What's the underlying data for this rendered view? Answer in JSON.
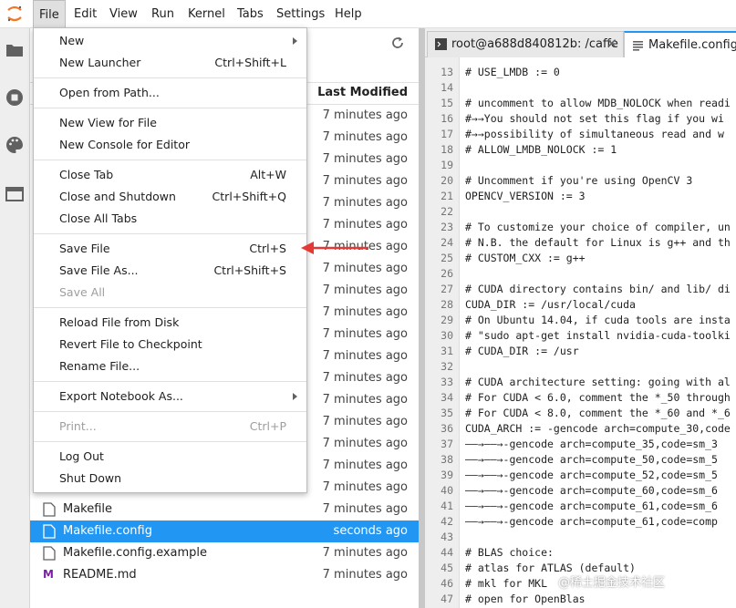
{
  "menubar": {
    "items": [
      "File",
      "Edit",
      "View",
      "Run",
      "Kernel",
      "Tabs",
      "Settings",
      "Help"
    ]
  },
  "file_menu": {
    "groups": [
      [
        {
          "label": "New",
          "shortcut": "",
          "submenu": true,
          "disabled": false
        },
        {
          "label": "New Launcher",
          "shortcut": "Ctrl+Shift+L",
          "submenu": false,
          "disabled": false
        }
      ],
      [
        {
          "label": "Open from Path...",
          "shortcut": "",
          "submenu": false,
          "disabled": false
        }
      ],
      [
        {
          "label": "New View for File",
          "shortcut": "",
          "submenu": false,
          "disabled": false
        },
        {
          "label": "New Console for Editor",
          "shortcut": "",
          "submenu": false,
          "disabled": false
        }
      ],
      [
        {
          "label": "Close Tab",
          "shortcut": "Alt+W",
          "submenu": false,
          "disabled": false
        },
        {
          "label": "Close and Shutdown",
          "shortcut": "Ctrl+Shift+Q",
          "submenu": false,
          "disabled": false
        },
        {
          "label": "Close All Tabs",
          "shortcut": "",
          "submenu": false,
          "disabled": false
        }
      ],
      [
        {
          "label": "Save File",
          "shortcut": "Ctrl+S",
          "submenu": false,
          "disabled": false
        },
        {
          "label": "Save File As...",
          "shortcut": "Ctrl+Shift+S",
          "submenu": false,
          "disabled": false
        },
        {
          "label": "Save All",
          "shortcut": "",
          "submenu": false,
          "disabled": true
        }
      ],
      [
        {
          "label": "Reload File from Disk",
          "shortcut": "",
          "submenu": false,
          "disabled": false
        },
        {
          "label": "Revert File to Checkpoint",
          "shortcut": "",
          "submenu": false,
          "disabled": false
        },
        {
          "label": "Rename File...",
          "shortcut": "",
          "submenu": false,
          "disabled": false
        }
      ],
      [
        {
          "label": "Export Notebook As...",
          "shortcut": "",
          "submenu": true,
          "disabled": false
        }
      ],
      [
        {
          "label": "Print...",
          "shortcut": "Ctrl+P",
          "submenu": false,
          "disabled": true
        }
      ],
      [
        {
          "label": "Log Out",
          "shortcut": "",
          "submenu": false,
          "disabled": false
        },
        {
          "label": "Shut Down",
          "shortcut": "",
          "submenu": false,
          "disabled": false
        }
      ]
    ]
  },
  "file_browser": {
    "column_last_modified": "Last Modified",
    "rows": [
      {
        "name": "",
        "modified": "7 minutes ago",
        "selected": false,
        "icon": ""
      },
      {
        "name": "",
        "modified": "7 minutes ago",
        "selected": false,
        "icon": ""
      },
      {
        "name": "",
        "modified": "7 minutes ago",
        "selected": false,
        "icon": ""
      },
      {
        "name": "",
        "modified": "7 minutes ago",
        "selected": false,
        "icon": ""
      },
      {
        "name": "",
        "modified": "7 minutes ago",
        "selected": false,
        "icon": ""
      },
      {
        "name": "",
        "modified": "7 minutes ago",
        "selected": false,
        "icon": ""
      },
      {
        "name": "",
        "modified": "7 minutes ago",
        "selected": false,
        "icon": ""
      },
      {
        "name": "",
        "modified": "7 minutes ago",
        "selected": false,
        "icon": ""
      },
      {
        "name": "",
        "modified": "7 minutes ago",
        "selected": false,
        "icon": ""
      },
      {
        "name": "",
        "modified": "7 minutes ago",
        "selected": false,
        "icon": ""
      },
      {
        "name": "",
        "modified": "7 minutes ago",
        "selected": false,
        "icon": ""
      },
      {
        "name": "",
        "modified": "7 minutes ago",
        "selected": false,
        "icon": ""
      },
      {
        "name": "",
        "modified": "7 minutes ago",
        "selected": false,
        "icon": ""
      },
      {
        "name": "",
        "modified": "7 minutes ago",
        "selected": false,
        "icon": ""
      },
      {
        "name": "",
        "modified": "7 minutes ago",
        "selected": false,
        "icon": ""
      },
      {
        "name": "",
        "modified": "7 minutes ago",
        "selected": false,
        "icon": ""
      },
      {
        "name": "",
        "modified": "7 minutes ago",
        "selected": false,
        "icon": ""
      },
      {
        "name": "",
        "modified": "7 minutes ago",
        "selected": false,
        "icon": ""
      },
      {
        "name": "Makefile",
        "modified": "7 minutes ago",
        "selected": false,
        "icon": "file-icon"
      },
      {
        "name": "Makefile.config",
        "modified": "seconds ago",
        "selected": true,
        "icon": "file-icon"
      },
      {
        "name": "Makefile.config.example",
        "modified": "7 minutes ago",
        "selected": false,
        "icon": "file-icon"
      },
      {
        "name": "README.md",
        "modified": "7 minutes ago",
        "selected": false,
        "icon": "markdown-icon"
      }
    ]
  },
  "tabs": [
    {
      "label": "root@a688d840812b: /caffe",
      "icon": "terminal-icon",
      "active": false
    },
    {
      "label": "Makefile.config",
      "icon": "text-file-icon",
      "active": true
    }
  ],
  "editor": {
    "lines": [
      {
        "n": "13",
        "text": "# USE_LMDB := 0"
      },
      {
        "n": "14",
        "text": ""
      },
      {
        "n": "15",
        "text": "# uncomment to allow MDB_NOLOCK when readi"
      },
      {
        "n": "16",
        "text": "#→→You should not set this flag if you wi"
      },
      {
        "n": "17",
        "text": "#→→possibility of simultaneous read and w"
      },
      {
        "n": "18",
        "text": "# ALLOW_LMDB_NOLOCK := 1"
      },
      {
        "n": "19",
        "text": ""
      },
      {
        "n": "20",
        "text": "# Uncomment if you're using OpenCV 3"
      },
      {
        "n": "21",
        "text": "OPENCV_VERSION := 3"
      },
      {
        "n": "22",
        "text": ""
      },
      {
        "n": "23",
        "text": "# To customize your choice of compiler, un"
      },
      {
        "n": "24",
        "text": "# N.B. the default for Linux is g++ and th"
      },
      {
        "n": "25",
        "text": "# CUSTOM_CXX := g++"
      },
      {
        "n": "26",
        "text": ""
      },
      {
        "n": "27",
        "text": "# CUDA directory contains bin/ and lib/ di"
      },
      {
        "n": "28",
        "text": "CUDA_DIR := /usr/local/cuda"
      },
      {
        "n": "29",
        "text": "# On Ubuntu 14.04, if cuda tools are insta"
      },
      {
        "n": "30",
        "text": "# \"sudo apt-get install nvidia-cuda-toolki"
      },
      {
        "n": "31",
        "text": "# CUDA_DIR := /usr"
      },
      {
        "n": "32",
        "text": ""
      },
      {
        "n": "33",
        "text": "# CUDA architecture setting: going with al"
      },
      {
        "n": "34",
        "text": "# For CUDA < 6.0, comment the *_50 through"
      },
      {
        "n": "35",
        "text": "# For CUDA < 8.0, comment the *_60 and *_6"
      },
      {
        "n": "36",
        "text": "CUDA_ARCH := -gencode arch=compute_30,code"
      },
      {
        "n": "37",
        "text": "——→——→-gencode arch=compute_35,code=sm_3"
      },
      {
        "n": "38",
        "text": "——→——→-gencode arch=compute_50,code=sm_5"
      },
      {
        "n": "39",
        "text": "——→——→-gencode arch=compute_52,code=sm_5"
      },
      {
        "n": "40",
        "text": "——→——→-gencode arch=compute_60,code=sm_6"
      },
      {
        "n": "41",
        "text": "——→——→-gencode arch=compute_61,code=sm_6"
      },
      {
        "n": "42",
        "text": "——→——→-gencode arch=compute_61,code=comp"
      },
      {
        "n": "43",
        "text": ""
      },
      {
        "n": "44",
        "text": "# BLAS choice:"
      },
      {
        "n": "45",
        "text": "# atlas for ATLAS (default)"
      },
      {
        "n": "46",
        "text": "# mkl for MKL"
      },
      {
        "n": "47",
        "text": "# open for OpenBlas"
      }
    ]
  },
  "watermark": "@稀土掘金技术社区",
  "colors": {
    "accent": "#2196f3",
    "annotation_arrow": "#e53935",
    "logo": "#f37726",
    "markdown_icon": "#7b1fa2"
  }
}
